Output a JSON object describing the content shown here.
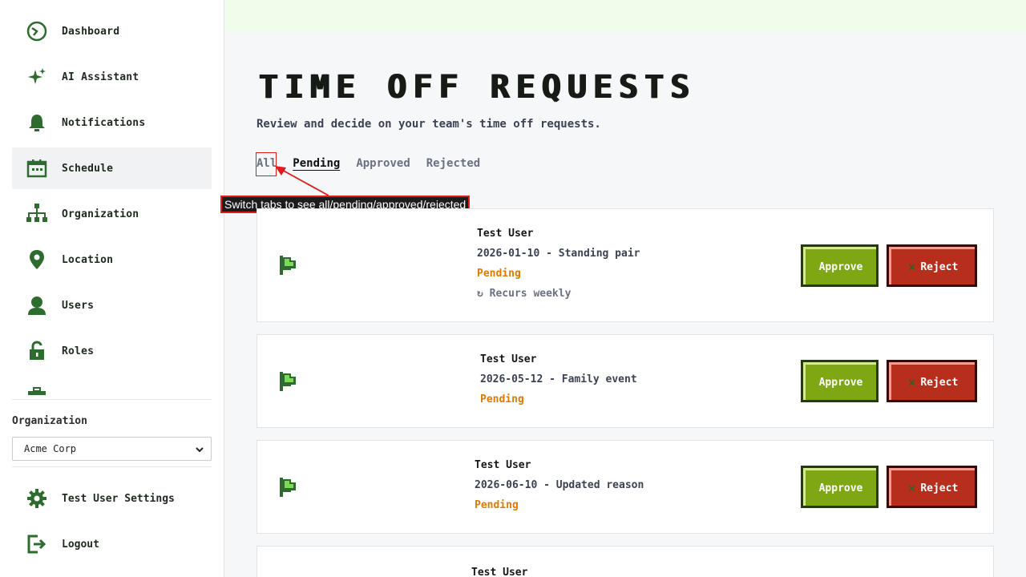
{
  "sidebar": {
    "nav": [
      {
        "label": "Dashboard",
        "icon": "dashboard-icon"
      },
      {
        "label": "AI Assistant",
        "icon": "sparkle-icon"
      },
      {
        "label": "Notifications",
        "icon": "bell-icon"
      },
      {
        "label": "Schedule",
        "icon": "calendar-icon",
        "active": true
      },
      {
        "label": "Organization",
        "icon": "org-chart-icon"
      },
      {
        "label": "Location",
        "icon": "map-pin-icon"
      },
      {
        "label": "Users",
        "icon": "user-icon"
      },
      {
        "label": "Roles",
        "icon": "lock-icon"
      }
    ],
    "org_label": "Organization",
    "org_selected": "Acme Corp",
    "settings_label": "Test User Settings",
    "logout_label": "Logout"
  },
  "main": {
    "title": "TIME OFF REQUESTS",
    "subtitle": "Review and decide on your team's time off requests.",
    "tabs": [
      {
        "label": "All"
      },
      {
        "label": "Pending",
        "active": true
      },
      {
        "label": "Approved"
      },
      {
        "label": "Rejected"
      }
    ],
    "tooltip": "Switch tabs to see all/pending/approved/rejected",
    "requests": [
      {
        "name": "Test User",
        "detail": "2026-01-10 - Standing pair",
        "status": "Pending",
        "recur": "↻ Recurs weekly"
      },
      {
        "name": "Test User",
        "detail": "2026-05-12 - Family event",
        "status": "Pending"
      },
      {
        "name": "Test User",
        "detail": "2026-06-10 - Updated reason",
        "status": "Pending"
      },
      {
        "name": "Test User"
      }
    ],
    "approve_label": "Approve",
    "reject_label": "Reject"
  },
  "colors": {
    "icon_green": "#2e6b2e",
    "approve": "#7ea713",
    "reject": "#b72e1d",
    "pending": "#e07a00",
    "top_band": "#f0fdea"
  }
}
